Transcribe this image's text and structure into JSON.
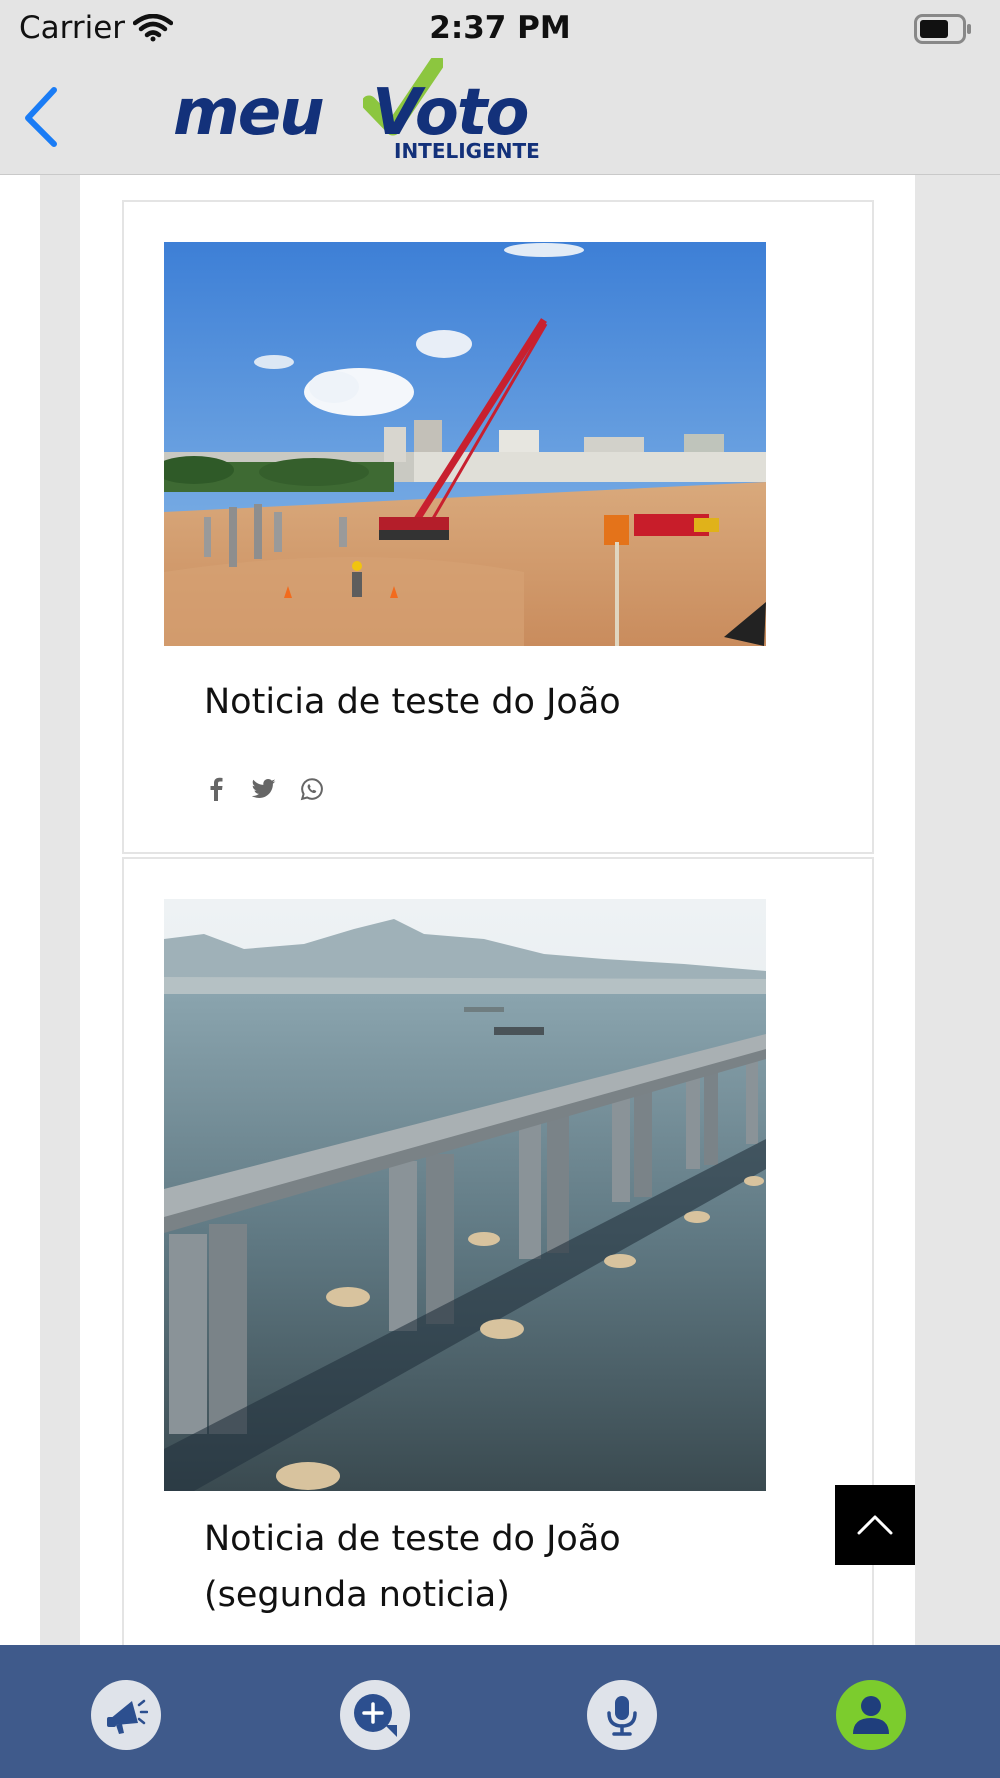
{
  "status_bar": {
    "carrier": "Carrier",
    "time": "2:37 PM",
    "icons": [
      "wifi-icon",
      "battery-icon"
    ]
  },
  "nav_bar": {
    "back_icon": "chevron-left-icon",
    "logo": {
      "word_1": "meu",
      "word_2": "Voto",
      "subtitle": "INTELIGENTE"
    }
  },
  "news": [
    {
      "title": "Noticia de teste do João",
      "image": "construction-site-photo",
      "share_icons": [
        "facebook-icon",
        "twitter-icon",
        "whatsapp-icon"
      ]
    },
    {
      "title_line_1": "Noticia de teste do João",
      "title_line_2": "(segunda noticia)",
      "image": "bridge-over-bay-photo"
    }
  ],
  "scroll_top_icon": "chevron-up-icon",
  "tab_bar": {
    "tabs": [
      "megaphone-icon",
      "add-message-icon",
      "microphone-icon",
      "profile-icon"
    ],
    "active_color": "#7ccc2d",
    "bar_color": "#3f5a8b"
  },
  "colors": {
    "accent_blue": "#1a7cf5",
    "logo_navy": "#13317a",
    "logo_green": "#8cc63f"
  }
}
